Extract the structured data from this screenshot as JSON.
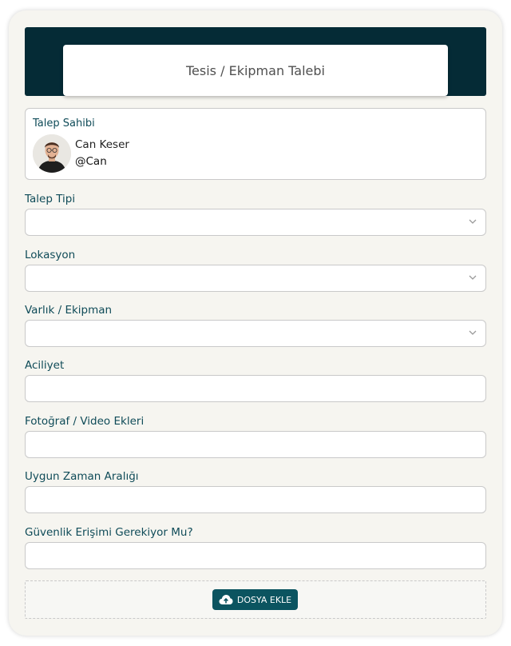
{
  "header": {
    "title": "Tesis / Ekipman Talebi"
  },
  "owner": {
    "label": "Talep Sahibi",
    "name": "Can Keser",
    "handle": "@Can"
  },
  "fields": [
    {
      "label": "Talep Tipi",
      "type": "select",
      "value": ""
    },
    {
      "label": "Lokasyon",
      "type": "select",
      "value": ""
    },
    {
      "label": "Varlık / Ekipman",
      "type": "select",
      "value": ""
    },
    {
      "label": "Aciliyet",
      "type": "text",
      "value": ""
    },
    {
      "label": "Fotoğraf / Video Ekleri",
      "type": "text",
      "value": ""
    },
    {
      "label": "Uygun Zaman Aralığı",
      "type": "text",
      "value": ""
    },
    {
      "label": "Güvenlik Erişimi Gerekiyor Mu?",
      "type": "text",
      "value": ""
    }
  ],
  "upload": {
    "button_label": "DOSYA EKLE",
    "icon": "cloud-upload-icon"
  },
  "colors": {
    "header_band": "#052b36",
    "accent": "#0b5460",
    "label": "#0f4b58"
  }
}
